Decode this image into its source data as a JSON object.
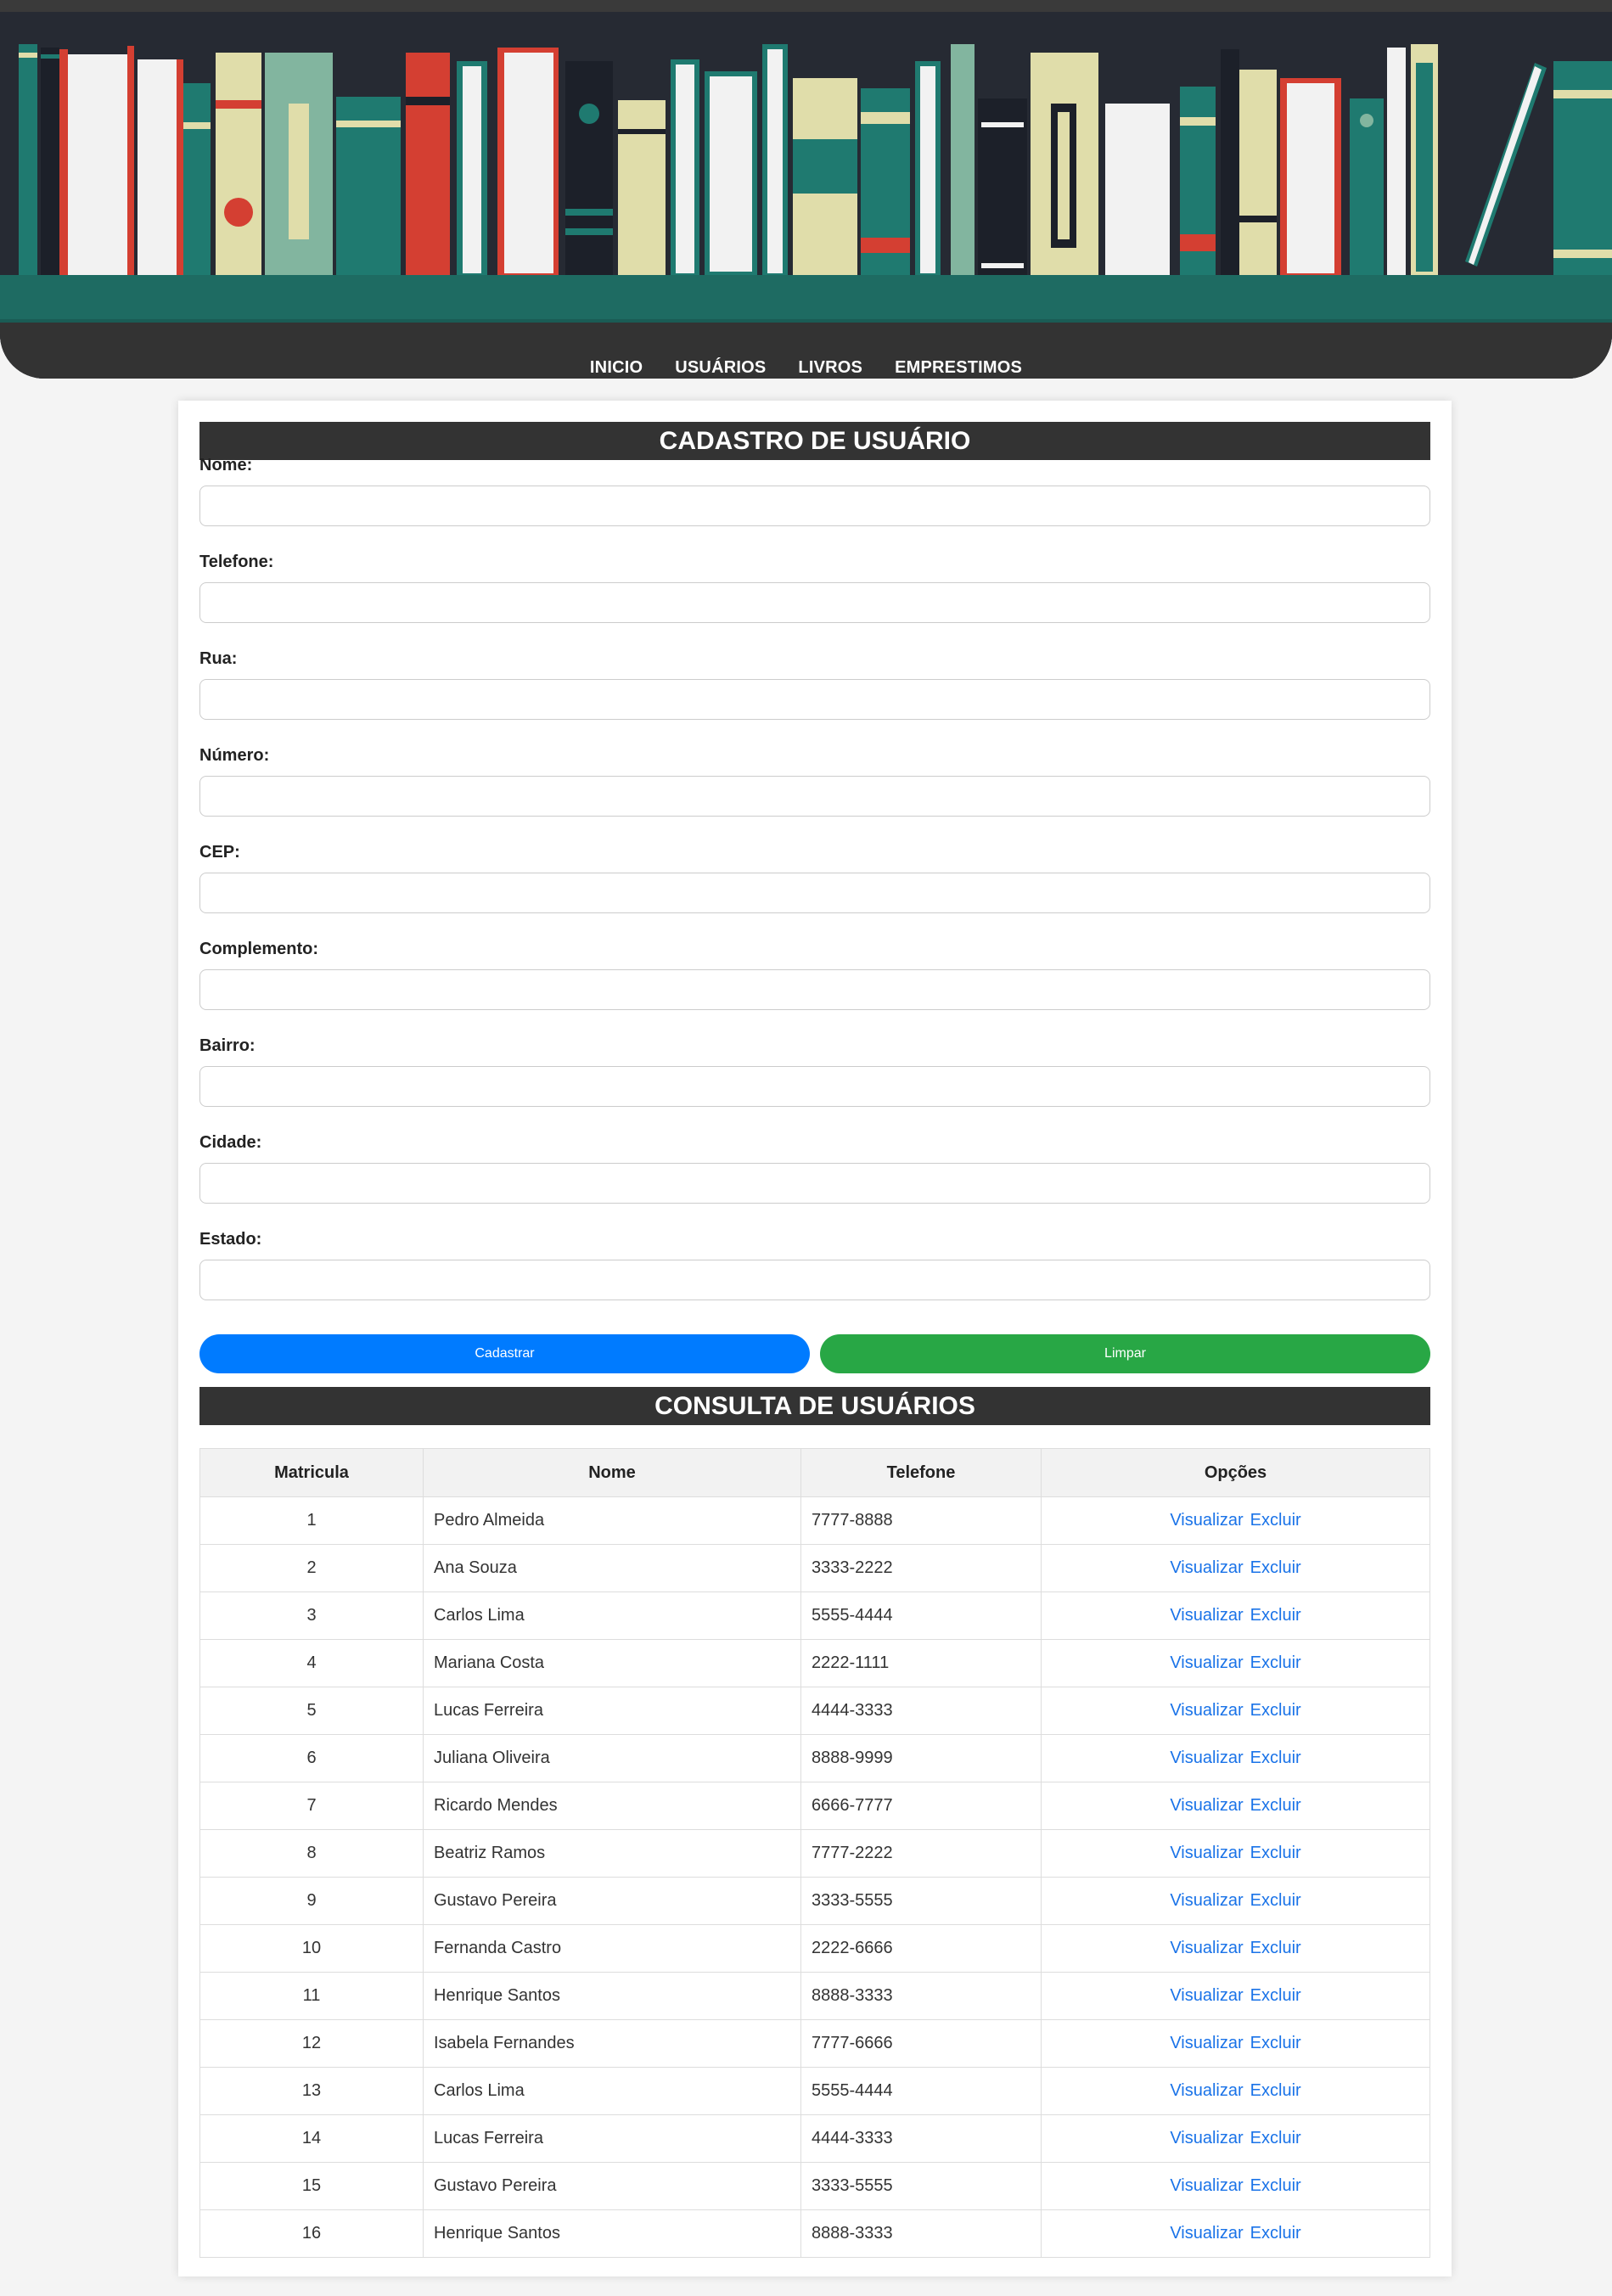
{
  "nav": {
    "items": [
      "INICIO",
      "USUÁRIOS",
      "LIVROS",
      "EMPRESTIMOS"
    ]
  },
  "form": {
    "title": "CADASTRO DE USUÁRIO",
    "fields": [
      {
        "label": "Nome:",
        "value": ""
      },
      {
        "label": "Telefone:",
        "value": ""
      },
      {
        "label": "Rua:",
        "value": ""
      },
      {
        "label": "Número:",
        "value": ""
      },
      {
        "label": "CEP:",
        "value": ""
      },
      {
        "label": "Complemento:",
        "value": ""
      },
      {
        "label": "Bairro:",
        "value": ""
      },
      {
        "label": "Cidade:",
        "value": ""
      },
      {
        "label": "Estado:",
        "value": ""
      }
    ],
    "submit_label": "Cadastrar",
    "clear_label": "Limpar"
  },
  "consulta": {
    "title": "CONSULTA DE USUÁRIOS",
    "columns": [
      "Matricula",
      "Nome",
      "Telefone",
      "Opções"
    ],
    "view_label": "Visualizar",
    "delete_label": "Excluir",
    "rows": [
      {
        "matricula": "1",
        "nome": "Pedro Almeida",
        "telefone": "7777-8888"
      },
      {
        "matricula": "2",
        "nome": "Ana Souza",
        "telefone": "3333-2222"
      },
      {
        "matricula": "3",
        "nome": "Carlos Lima",
        "telefone": "5555-4444"
      },
      {
        "matricula": "4",
        "nome": "Mariana Costa",
        "telefone": "2222-1111"
      },
      {
        "matricula": "5",
        "nome": "Lucas Ferreira",
        "telefone": "4444-3333"
      },
      {
        "matricula": "6",
        "nome": "Juliana Oliveira",
        "telefone": "8888-9999"
      },
      {
        "matricula": "7",
        "nome": "Ricardo Mendes",
        "telefone": "6666-7777"
      },
      {
        "matricula": "8",
        "nome": "Beatriz Ramos",
        "telefone": "7777-2222"
      },
      {
        "matricula": "9",
        "nome": "Gustavo Pereira",
        "telefone": "3333-5555"
      },
      {
        "matricula": "10",
        "nome": "Fernanda Castro",
        "telefone": "2222-6666"
      },
      {
        "matricula": "11",
        "nome": "Henrique Santos",
        "telefone": "8888-3333"
      },
      {
        "matricula": "12",
        "nome": "Isabela Fernandes",
        "telefone": "7777-6666"
      },
      {
        "matricula": "13",
        "nome": "Carlos Lima",
        "telefone": "5555-4444"
      },
      {
        "matricula": "14",
        "nome": "Lucas Ferreira",
        "telefone": "4444-3333"
      },
      {
        "matricula": "15",
        "nome": "Gustavo Pereira",
        "telefone": "3333-5555"
      },
      {
        "matricula": "16",
        "nome": "Henrique Santos",
        "telefone": "8888-3333"
      }
    ]
  },
  "colors": {
    "header_bg": "#262a33",
    "shelf": "#1e6b62",
    "teal": "#1f7a70",
    "cream": "#e0ddaa",
    "red": "#d43f32",
    "white_book": "#f2f2f2",
    "primary": "#007bff",
    "success": "#28a745",
    "link": "#1a73e8"
  }
}
